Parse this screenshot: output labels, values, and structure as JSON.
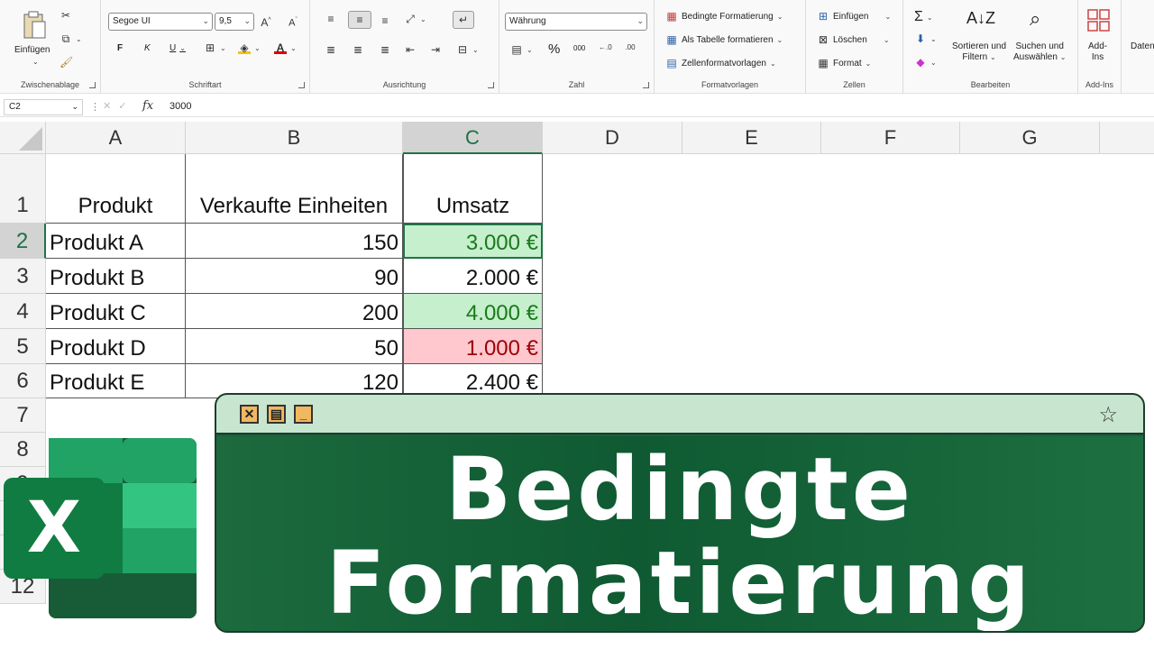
{
  "ribbon": {
    "clipboard": {
      "paste": "Einfügen",
      "label": "Zwischenablage"
    },
    "font": {
      "name": "Segoe UI",
      "size": "9,5",
      "bold": "F",
      "italic": "K",
      "underline": "U",
      "label": "Schriftart"
    },
    "alignment": {
      "label": "Ausrichtung"
    },
    "number": {
      "format": "Währung",
      "percent": "%",
      "thousands": "000",
      "label": "Zahl"
    },
    "styles": {
      "conditional": "Bedingte Formatierung",
      "as_table": "Als Tabelle formatieren",
      "cell_styles": "Zellenformatvorlagen",
      "label": "Formatvorlagen"
    },
    "cells": {
      "insert": "Einfügen",
      "delete": "Löschen",
      "format": "Format",
      "label": "Zellen"
    },
    "editing": {
      "sort_filter_1": "Sortieren und",
      "sort_filter_2": "Filtern",
      "find_1": "Suchen und",
      "find_2": "Auswählen",
      "label": "Bearbeiten"
    },
    "addins": {
      "addins_1": "Add-",
      "addins_2": "Ins",
      "label": "Add-Ins"
    },
    "data": {
      "label": "Daten"
    }
  },
  "formula_bar": {
    "name_box": "C2",
    "fx": "fx",
    "value": "3000"
  },
  "columns": [
    "A",
    "B",
    "C",
    "D",
    "E",
    "F",
    "G"
  ],
  "rows": [
    "1",
    "2",
    "3",
    "4",
    "5",
    "6",
    "7",
    "8",
    "9",
    "12"
  ],
  "table": {
    "headers": [
      "Produkt",
      "Verkaufte Einheiten",
      "Umsatz"
    ],
    "data": [
      {
        "product": "Produkt A",
        "units": "150",
        "revenue": "3.000 €",
        "status": "high"
      },
      {
        "product": "Produkt B",
        "units": "90",
        "revenue": "2.000 €",
        "status": "normal"
      },
      {
        "product": "Produkt C",
        "units": "200",
        "revenue": "4.000 €",
        "status": "high"
      },
      {
        "product": "Produkt D",
        "units": "50",
        "revenue": "1.000 €",
        "status": "low"
      },
      {
        "product": "Produkt E",
        "units": "120",
        "revenue": "2.400 €",
        "status": "normal"
      }
    ]
  },
  "colors": {
    "high_fill": "#c6efce",
    "high_text": "#1a7a1a",
    "low_fill": "#ffc7ce",
    "low_text": "#9c0006",
    "accent": "#217346",
    "banner_bg": "#1d5f3c",
    "banner_bar": "#c8e6cf"
  },
  "banner": {
    "line1": "Bedingte",
    "line2": "Formatierung",
    "icons": [
      "close-icon",
      "restore-icon",
      "minimize-icon",
      "star-icon"
    ]
  },
  "logo": {
    "letter": "X"
  }
}
